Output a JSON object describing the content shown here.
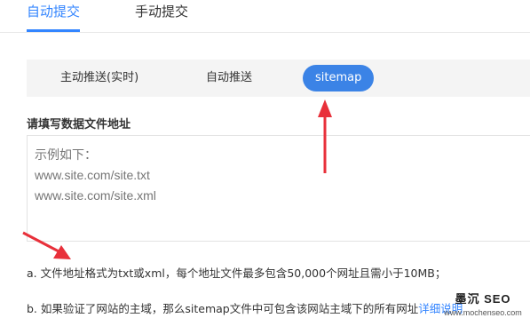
{
  "top_tabs": {
    "auto": "自动提交",
    "manual": "手动提交"
  },
  "sub_tabs": {
    "active_push": "主动推送(实时)",
    "auto_push": "自动推送",
    "sitemap": "sitemap"
  },
  "form": {
    "label": "请填写数据文件地址",
    "placeholder": "示例如下：\nwww.site.com/site.txt\nwww.site.com/site.xml"
  },
  "notes": {
    "a": "a. 文件地址格式为txt或xml，每个地址文件最多包含50,000个网址且需小于10MB；",
    "b_text": "b. 如果验证了网站的主域，那么sitemap文件中可包含该网站主域下的所有网址",
    "b_link": "详细说明"
  },
  "watermark": {
    "title": "墨沉 SEO",
    "url": "www.mochenseo.com"
  },
  "colors": {
    "accent": "#3385ff",
    "pill": "#3b83e6",
    "arrow": "#e8303a"
  },
  "icons": [
    "red-arrow-icon",
    "red-arrow-icon"
  ]
}
